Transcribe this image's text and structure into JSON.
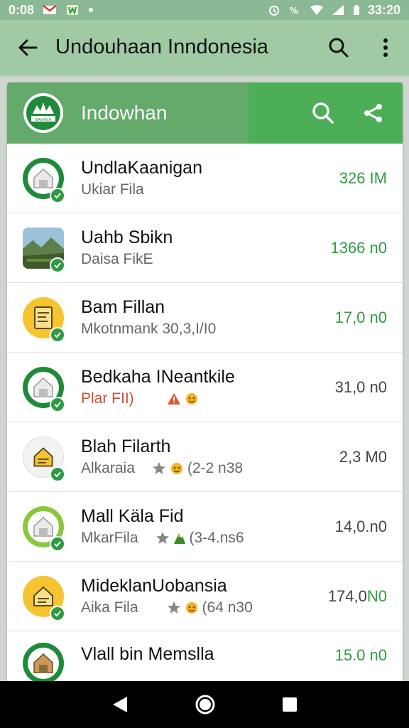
{
  "status_bar": {
    "time_left": "0:08",
    "time_right": "33:20"
  },
  "app_bar": {
    "title": "Undouhaan Inndonesia"
  },
  "card_header": {
    "brand_name": "Indowhan",
    "logo_text": "BAHASA"
  },
  "colors": {
    "accent": "#4caf57",
    "appbar": "#9fcaa4",
    "size_green": "#2e9a43"
  },
  "items": [
    {
      "title": "UndlaKaanigan",
      "subtitle": "Ukiar Fila",
      "size": "326 IM",
      "icon": "house-icon",
      "size_color": "green"
    },
    {
      "title": "Uahb Sbikn",
      "subtitle": "Daisa FikE",
      "size": "1366 n0",
      "icon": "landscape-photo",
      "size_color": "green"
    },
    {
      "title": "Bam Fillan",
      "subtitle": "Mkotnmank 30,3,I/I0",
      "size": "17,0 n0",
      "icon": "document-icon",
      "size_color": "green"
    },
    {
      "title": "Bedkaha INeantkile",
      "subtitle": "Plar FII)",
      "size": "31,0 n0",
      "icon": "house-icon",
      "size_color": "gray"
    },
    {
      "title": "Blah Filarth",
      "subtitle": "Alkaraia",
      "meta": "(2-2 n38",
      "size": "2,3 M0",
      "icon": "house-icon",
      "size_color": "gray"
    },
    {
      "title": "Mall Käla Fid",
      "subtitle": "MkarFila",
      "meta": "(3-4.ns6",
      "size": "14,0.n0",
      "icon": "house-icon",
      "size_color": "gray"
    },
    {
      "title": "MideklanUobansia",
      "subtitle": "Aika Fila",
      "meta": "(64 n30",
      "size": "174,0 N0",
      "icon": "house-icon",
      "size_color": "mixed"
    },
    {
      "title": "Vlall bin Memslla",
      "subtitle": "",
      "size": "15.0 n0",
      "icon": "house-icon",
      "size_color": "green"
    }
  ]
}
